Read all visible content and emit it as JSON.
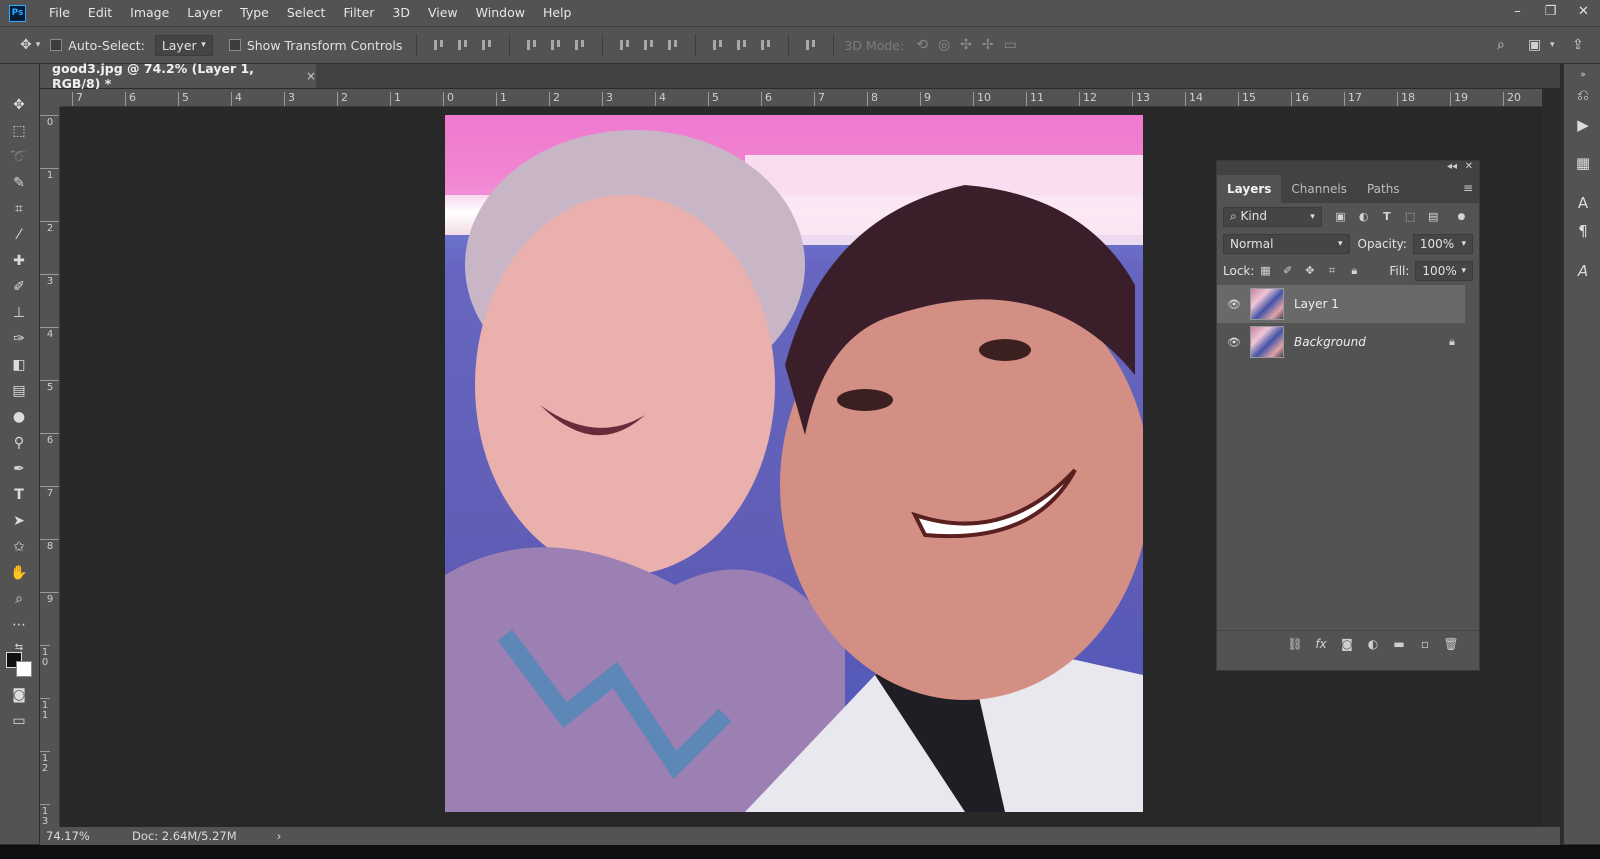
{
  "menu": {
    "items": [
      "File",
      "Edit",
      "Image",
      "Layer",
      "Type",
      "Select",
      "Filter",
      "3D",
      "View",
      "Window",
      "Help"
    ],
    "app_logo": "Ps"
  },
  "window_controls": {
    "minimize": "–",
    "restore": "❐",
    "close": "✕"
  },
  "options": {
    "auto_select_label": "Auto-Select:",
    "auto_select_target": "Layer",
    "show_transform_label": "Show Transform Controls",
    "mode_3d_label": "3D Mode:"
  },
  "document": {
    "tab_title": "good3.jpg @ 74.2% (Layer 1, RGB/8) *",
    "tab_close": "×"
  },
  "rulers": {
    "horizontal": [
      "7",
      "6",
      "5",
      "4",
      "3",
      "2",
      "1",
      "0",
      "1",
      "2",
      "3",
      "4",
      "5",
      "6",
      "7",
      "8",
      "9",
      "10",
      "11",
      "12",
      "13",
      "14",
      "15",
      "16",
      "17",
      "18",
      "19",
      "20"
    ],
    "vertical": [
      "0",
      "1",
      "2",
      "3",
      "4",
      "5",
      "6",
      "7",
      "8",
      "9",
      "1 0",
      "1 1",
      "1 2",
      "1 3"
    ]
  },
  "layers_panel": {
    "tabs": [
      "Layers",
      "Channels",
      "Paths"
    ],
    "filter_kind": "Kind",
    "blend_mode": "Normal",
    "opacity_label": "Opacity:",
    "opacity_value": "100%",
    "lock_label": "Lock:",
    "fill_label": "Fill:",
    "fill_value": "100%",
    "layers": [
      {
        "name": "Layer 1",
        "selected": true,
        "locked": false
      },
      {
        "name": "Background",
        "selected": false,
        "locked": true
      }
    ]
  },
  "status": {
    "zoom": "74.17%",
    "doc_size": "Doc: 2.64M/5.27M",
    "arrow": "›"
  },
  "icons": {
    "move": "move-icon",
    "marquee": "rectangular-marquee-icon",
    "lasso": "lasso-icon",
    "quick_select": "quick-selection-icon",
    "crop": "crop-icon",
    "eyedropper": "eyedropper-icon",
    "healing": "healing-brush-icon",
    "brush": "brush-icon",
    "stamp": "clone-stamp-icon",
    "history_brush": "history-brush-icon",
    "eraser": "eraser-icon",
    "gradient": "gradient-icon",
    "blur": "blur-icon",
    "dodge": "dodge-icon",
    "pen": "pen-icon",
    "type": "type-icon",
    "path_select": "path-selection-icon",
    "shape": "shape-icon",
    "hand": "hand-icon",
    "zoom": "zoom-icon"
  },
  "colors": {
    "panel_bg": "#535353",
    "canvas_bg": "#282828",
    "selected_layer": "#696969"
  }
}
